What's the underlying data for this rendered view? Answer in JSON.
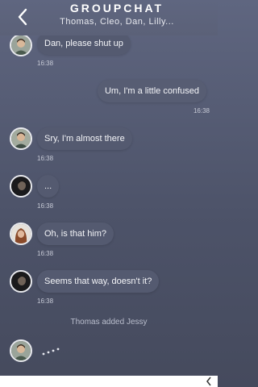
{
  "header": {
    "title": "GROUPCHAT",
    "subtitle": "Thomas, Cleo, Dan, Lilly..."
  },
  "messages": [
    {
      "text": "Dan, please shut up",
      "time": "16:38",
      "side": "in",
      "sender_icon": "man-avatar"
    },
    {
      "text": "Um, I'm a little confused",
      "time": "16:38",
      "side": "out"
    },
    {
      "text": "Sry, I'm almost there",
      "time": "16:38",
      "side": "in",
      "sender_icon": "man-avatar"
    },
    {
      "text": "...",
      "time": "16:38",
      "side": "in",
      "sender_icon": "dark-avatar"
    },
    {
      "text": "Oh, is that him?",
      "time": "16:38",
      "side": "in",
      "sender_icon": "woman-avatar"
    },
    {
      "text": "Seems that way, doesn't it?",
      "time": "16:38",
      "side": "in",
      "sender_icon": "dark-avatar"
    }
  ],
  "system_message": "Thomas added Jessy",
  "icons": {
    "back": "chevron-left-icon",
    "typing": "typing-dots-icon"
  },
  "colors": {
    "background_top": "#5f6680",
    "background_bottom": "#454a5d",
    "bubble": "#545a70"
  }
}
